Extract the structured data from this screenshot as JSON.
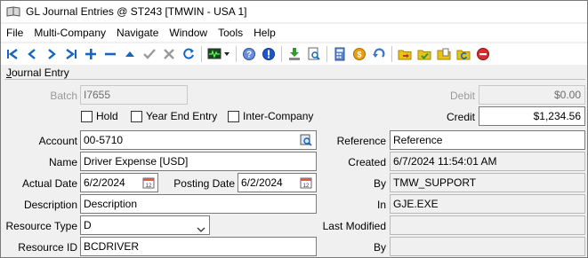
{
  "window": {
    "title": "GL Journal Entries @ ST243 [TMWIN - USA 1]"
  },
  "menu": [
    "File",
    "Multi-Company",
    "Navigate",
    "Window",
    "Tools",
    "Help"
  ],
  "section": {
    "accel": "J",
    "rest": "ournal Entry"
  },
  "form": {
    "batch_label": "Batch",
    "batch_value": "I7655",
    "debit_label": "Debit",
    "debit_value": "$0.00",
    "credit_label": "Credit",
    "credit_value": "$1,234.56",
    "hold_label": "Hold",
    "year_end_label": "Year End Entry",
    "inter_company_label": "Inter-Company",
    "account_label": "Account",
    "account_value": "00-5710",
    "name_label": "Name",
    "name_value": "Driver Expense [USD]",
    "actual_date_label": "Actual Date",
    "actual_date_value": "6/2/2024",
    "posting_date_label": "Posting Date",
    "posting_date_value": "6/2/2024",
    "description_label": "Description",
    "description_value": "Description",
    "resource_type_label": "Resource Type",
    "resource_type_value": "D",
    "resource_id_label": "Resource ID",
    "resource_id_value": "BCDRIVER",
    "reference_label": "Reference",
    "reference_value": "Reference",
    "created_label": "Created",
    "created_value": "6/7/2024 11:54:01 AM",
    "by_label": "By",
    "by_value": "TMW_SUPPORT",
    "in_label": "In",
    "in_value": "GJE.EXE",
    "last_modified_label": "Last Modified",
    "last_modified_value": "",
    "by2_label": "By",
    "by2_value": ""
  },
  "colors": {
    "nav_blue": "#1565c0",
    "disabled_gray": "#9a9a9a",
    "green": "#2e9b2e",
    "red": "#d32f2f",
    "yellow": "#e8c21a"
  }
}
